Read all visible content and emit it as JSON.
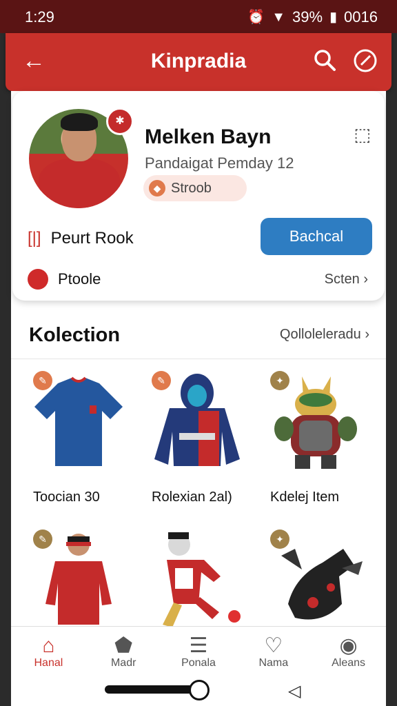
{
  "status_bar": {
    "time": "1:29",
    "battery": "39%",
    "right_text": "0016"
  },
  "app_bar": {
    "title": "Kinpradia"
  },
  "profile": {
    "name": "Melken Bayn",
    "subtitle": "Pandaigat Pemday 12",
    "tag": "Stroob",
    "row1_label": "Peurt Rook",
    "action_button": "Bachcal",
    "row2_label": "Ptoole",
    "settings_link": "Scten"
  },
  "collection": {
    "title": "Kolection",
    "view_all": "Qolloleleradu",
    "items": [
      {
        "label": "Toocian 30"
      },
      {
        "label": "Rolexian 2al)"
      },
      {
        "label": "Kdelej Item"
      },
      {
        "label": ""
      },
      {
        "label": ""
      },
      {
        "label": ""
      }
    ]
  },
  "bottom_nav": [
    {
      "label": "Hanal",
      "icon": "home-icon",
      "active": true
    },
    {
      "label": "Madr",
      "icon": "shop-icon"
    },
    {
      "label": "Ponala",
      "icon": "list-icon"
    },
    {
      "label": "Nama",
      "icon": "heart-icon"
    },
    {
      "label": "Aleans",
      "icon": "profile-icon"
    }
  ],
  "colors": {
    "accent": "#c8312b",
    "button": "#2e7dc2"
  }
}
